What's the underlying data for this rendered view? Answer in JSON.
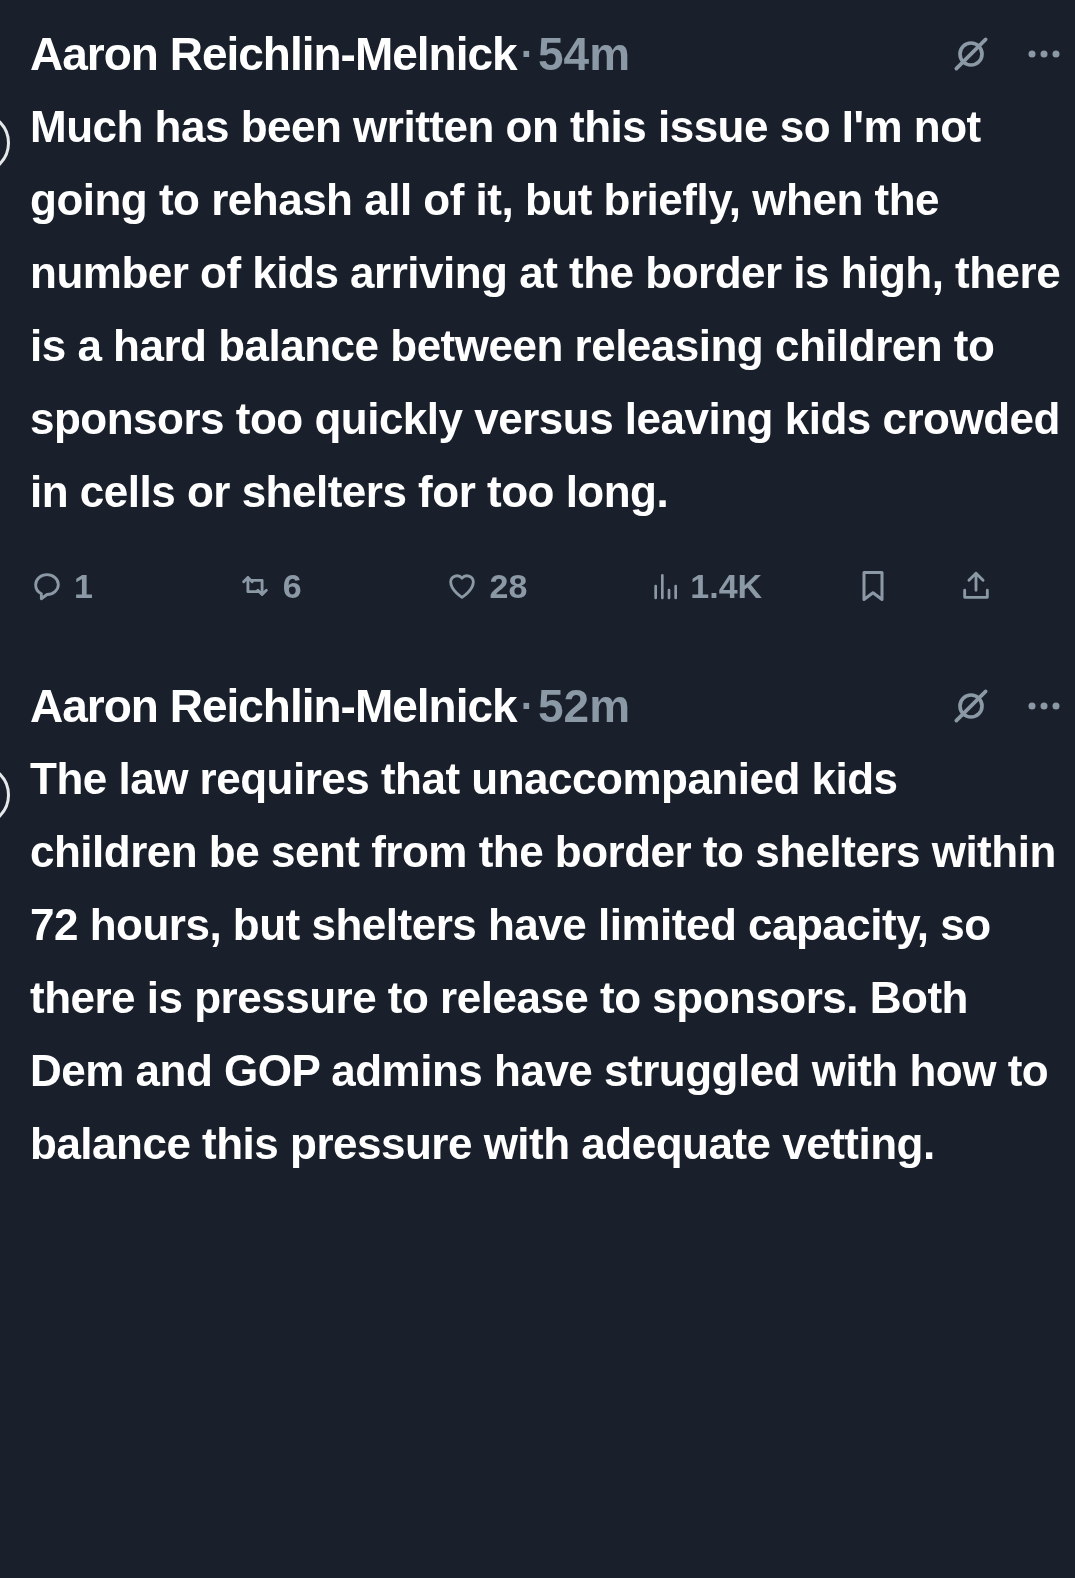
{
  "tweets": [
    {
      "author": "Aaron Reichlin-Melnick",
      "separator": "·",
      "time": "54m",
      "text": "Much has been written on this issue so I'm not going to rehash all of it, but briefly, when the number of kids arriving at the border is high, there is a hard balance between releasing children to sponsors too quickly versus leaving kids crowded in cells or shelters for too long.",
      "actions": [
        {
          "kind": "reply",
          "count": "1"
        },
        {
          "kind": "repost",
          "count": "6"
        },
        {
          "kind": "like",
          "count": "28"
        },
        {
          "kind": "views",
          "count": "1.4K"
        },
        {
          "kind": "bookmark"
        },
        {
          "kind": "share"
        }
      ]
    },
    {
      "author": "Aaron Reichlin-Melnick",
      "separator": "·",
      "time": "52m",
      "text": "The law requires that unaccompanied kids children be sent from the border to shelters within 72 hours, but shelters have limited capacity, so there is pressure to release to sponsors. Both Dem and GOP admins have struggled with how to balance this pressure with adequate vetting."
    }
  ]
}
